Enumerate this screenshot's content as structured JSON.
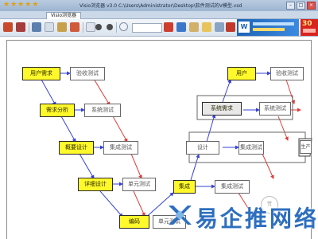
{
  "window": {
    "title": "Visio浏览器 v3.0 C:\\Users\\Administrator\\Desktop\\软件测试的V模型.vsd",
    "tab_label": "Visio浏览器"
  },
  "colors": {
    "node_yellow": "#fff82a",
    "arrow_blue": "#3340d6",
    "arrow_red": "#e33b3b",
    "watermark": "#2d6fbe"
  },
  "toolbar_icons": [
    "open-icon",
    "print-icon",
    "save-icon",
    "page-setup-icon",
    "fit-page-icon",
    "fit-width-icon",
    "first-page-icon",
    "prev-page-icon",
    "next-page-icon",
    "search-icon",
    "find-next-icon",
    "find-prev-icon",
    "zoom-icon",
    "page-view-icon",
    "thumbnail-icon",
    "info-icon"
  ],
  "diagram": {
    "left": [
      {
        "label": "用户需求",
        "test": "验收测试"
      },
      {
        "label": "需求分析",
        "test": "系统测试"
      },
      {
        "label": "概要设计",
        "test": "集成测试"
      },
      {
        "label": "详细设计",
        "test": "单元测试"
      },
      {
        "label": "编码",
        "test": "单元测试"
      }
    ],
    "right": [
      {
        "label": "用户",
        "test": "验收测试"
      },
      {
        "label": "系统需求",
        "test": "系统测试"
      },
      {
        "label": "设计",
        "test": "集成测试"
      },
      {
        "label": "集成",
        "test": "集成测试"
      }
    ],
    "right_stub": "生产"
  },
  "watermark": {
    "text": "易企推网络"
  },
  "stamp_text": "赞"
}
